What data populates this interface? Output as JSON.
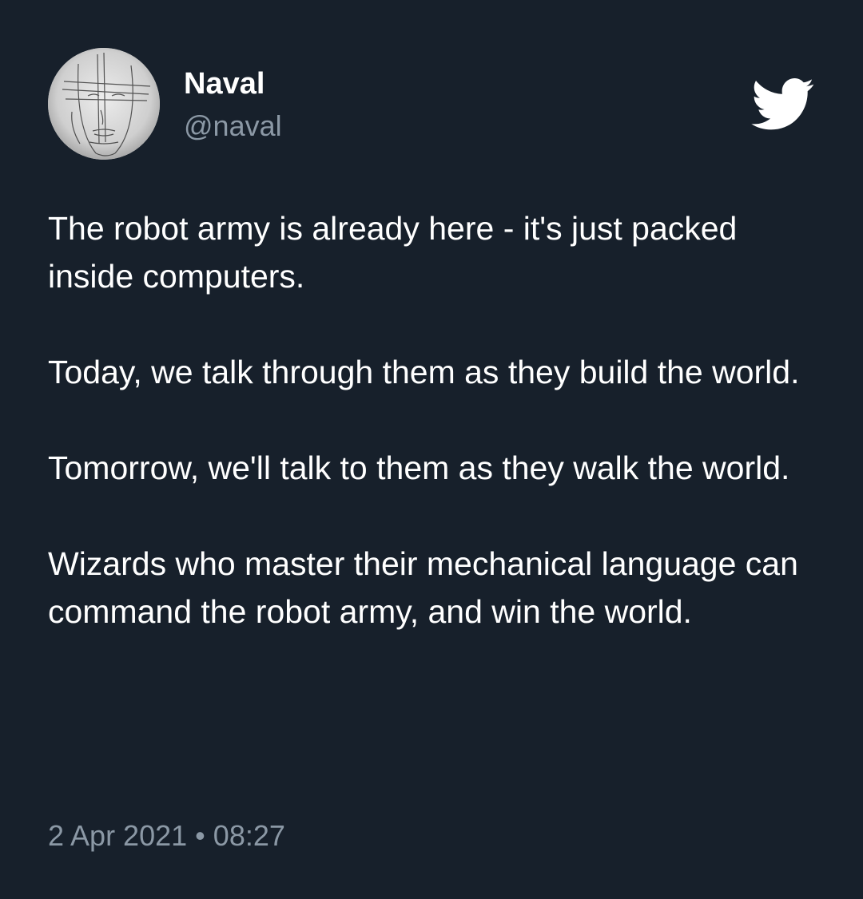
{
  "author": {
    "display_name": "Naval",
    "handle": "@naval",
    "avatar_icon": "sketch-face-avatar"
  },
  "brand_icon": "twitter-bird-icon",
  "colors": {
    "background": "#17202b",
    "primary_text": "#ffffff",
    "secondary_text": "#8b98a5"
  },
  "tweet": {
    "paragraphs": [
      "The robot army is already here - it's just packed inside computers.",
      "Today, we talk through them as they build the world.",
      "Tomorrow, we'll talk to them as they walk the world.",
      "Wizards who master their mechanical language can command the robot army, and win the world."
    ],
    "date": "2 Apr 2021",
    "separator": "•",
    "time": "08:27"
  }
}
